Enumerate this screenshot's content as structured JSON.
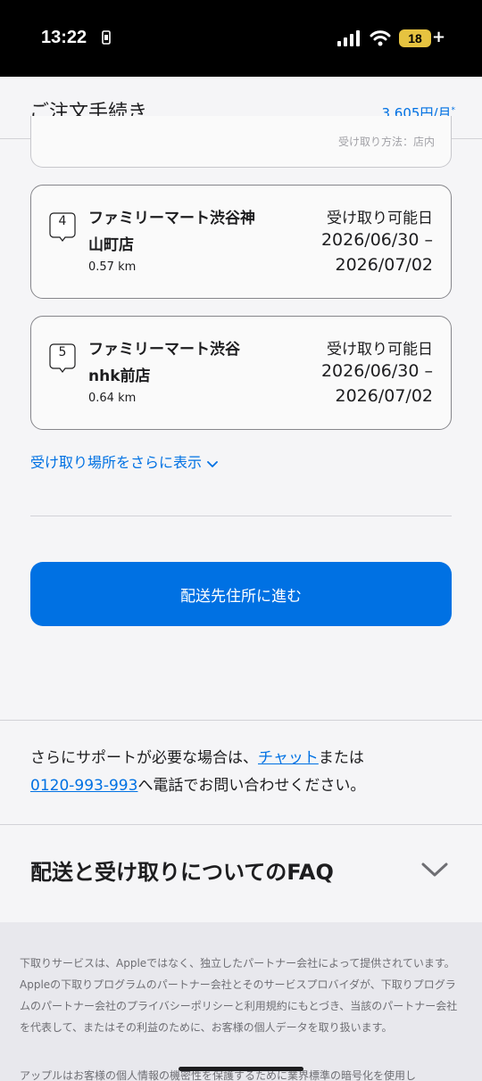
{
  "status_bar": {
    "time": "13:22",
    "battery": "18",
    "plus": "+"
  },
  "header": {
    "title": "ご注文手続き",
    "price": "3,605円/月",
    "price_note": "*"
  },
  "partial_card": {
    "text": "受け取り方法：店内"
  },
  "stores": [
    {
      "number": "4",
      "name_line1": "ファミリーマート渋谷神",
      "name_line2": "山町店",
      "distance": "0.57 km",
      "pickup_label": "受け取り可能日",
      "date_from": "2026/06/30 –",
      "date_to": "2026/07/02"
    },
    {
      "number": "5",
      "name_line1": "ファミリーマート渋谷",
      "name_line2": "nhk前店",
      "distance": "0.64 km",
      "pickup_label": "受け取り可能日",
      "date_from": "2026/06/30 –",
      "date_to": "2026/07/02"
    }
  ],
  "more_link": "受け取り場所をさらに表示",
  "cta_label": "配送先住所に進む",
  "support": {
    "prefix": "さらにサポートが必要な場合は、",
    "chat_link": "チャット",
    "middle": "または",
    "phone_link": "0120-993-993",
    "suffix": "へ電話でお問い合わせください。"
  },
  "faq_title": "配送と受け取りについてのFAQ",
  "footer": {
    "paragraph1": "下取りサービスは、Appleではなく、独立したパートナー会社によって提供されています。Appleの下取りプログラムのパートナー会社とそのサービスプロバイダが、下取りプログラムのパートナー会社のプライバシーポリシーと利用規約にもとづき、当該のパートナー会社を代表して、またはその利益のために、お客様の個人データを取り扱います。",
    "paragraph2": "アップルはお客様の個人情報の機密性を保護するために業界標準の暗号化を使用し"
  },
  "colors": {
    "accent": "#0071e3",
    "background": "#f5f5f7",
    "text": "#1d1d1f"
  }
}
